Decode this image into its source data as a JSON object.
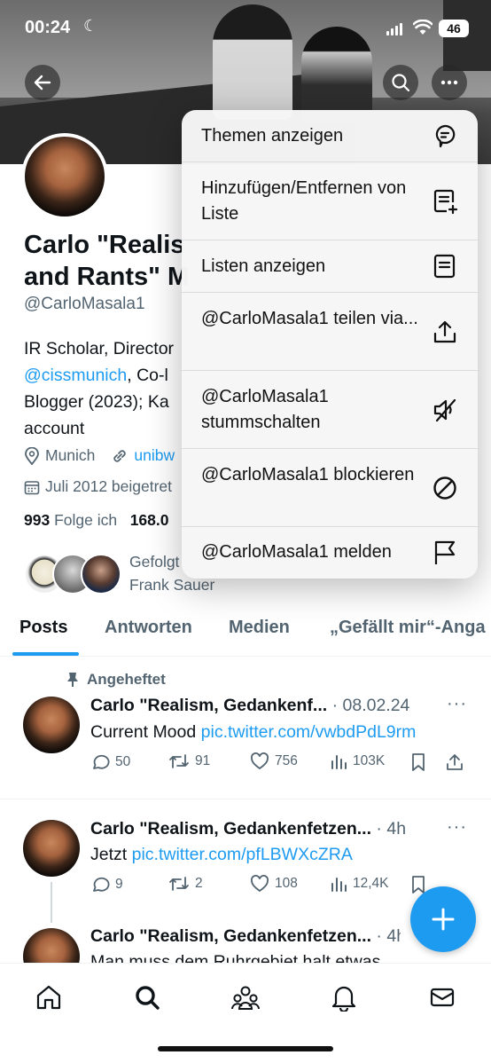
{
  "status_bar": {
    "time": "00:24",
    "battery": "46"
  },
  "profile": {
    "name": "Carlo \"Realism, Gedankenfetzen and Rants\" M",
    "name_line1": "Carlo \"Realis",
    "name_line2": "and Rants\" M",
    "handle": "@CarloMasala1",
    "bio": {
      "line1": "IR Scholar, Director",
      "line2_link": "@cissmunich",
      "line2_rest": ", Co-l",
      "line3": "Blogger (2023); Ka",
      "line4": "account"
    },
    "location": "Munich",
    "website": "unibw",
    "joined": "Juli 2012 beigetret",
    "following_count": "993",
    "following_label": "Folge ich",
    "followers_count": "168.0",
    "followed_by_line1": "Gefolgt",
    "followed_by_line2": "Frank Sauer"
  },
  "tabs": [
    "Posts",
    "Antworten",
    "Medien",
    "„Gefällt mir“-Anga"
  ],
  "posts": [
    {
      "pinned_label": "Angeheftet",
      "author": "Carlo \"Realism, Gedankenf...",
      "meta": " · 08.02.24",
      "text": "Current Mood ",
      "link": "pic.twitter.com/vwbdPdL9rm",
      "replies": "50",
      "reposts": "91",
      "likes": "756",
      "views": "103K"
    },
    {
      "author": "Carlo \"Realism, Gedankenfetzen...",
      "meta": " · 4h",
      "text": "Jetzt ",
      "link": "pic.twitter.com/pfLBWXcZRA",
      "replies": "9",
      "reposts": "2",
      "likes": "108",
      "views": "12,4K"
    },
    {
      "author": "Carlo \"Realism, Gedankenfetzen...",
      "meta": " · 4h",
      "text": "Man muss dem Ruhrgebiet halt etwas"
    }
  ],
  "menu": {
    "items": [
      {
        "label": "Themen anzeigen",
        "icon": "topics-bubble-icon"
      },
      {
        "label": "Hinzufügen/Entfernen von Liste",
        "icon": "list-add-icon"
      },
      {
        "label": "Listen anzeigen",
        "icon": "lists-icon"
      },
      {
        "label": "@CarloMasala1 teilen via...",
        "icon": "share-icon"
      },
      {
        "label": "@CarloMasala1 stummschalten",
        "icon": "mute-icon"
      },
      {
        "label": "@CarloMasala1 blockieren",
        "icon": "block-icon"
      },
      {
        "label": "@CarloMasala1 melden",
        "icon": "flag-icon"
      }
    ]
  },
  "colors": {
    "accent": "#1d9bf0",
    "text": "#0f1419",
    "muted": "#536471"
  }
}
